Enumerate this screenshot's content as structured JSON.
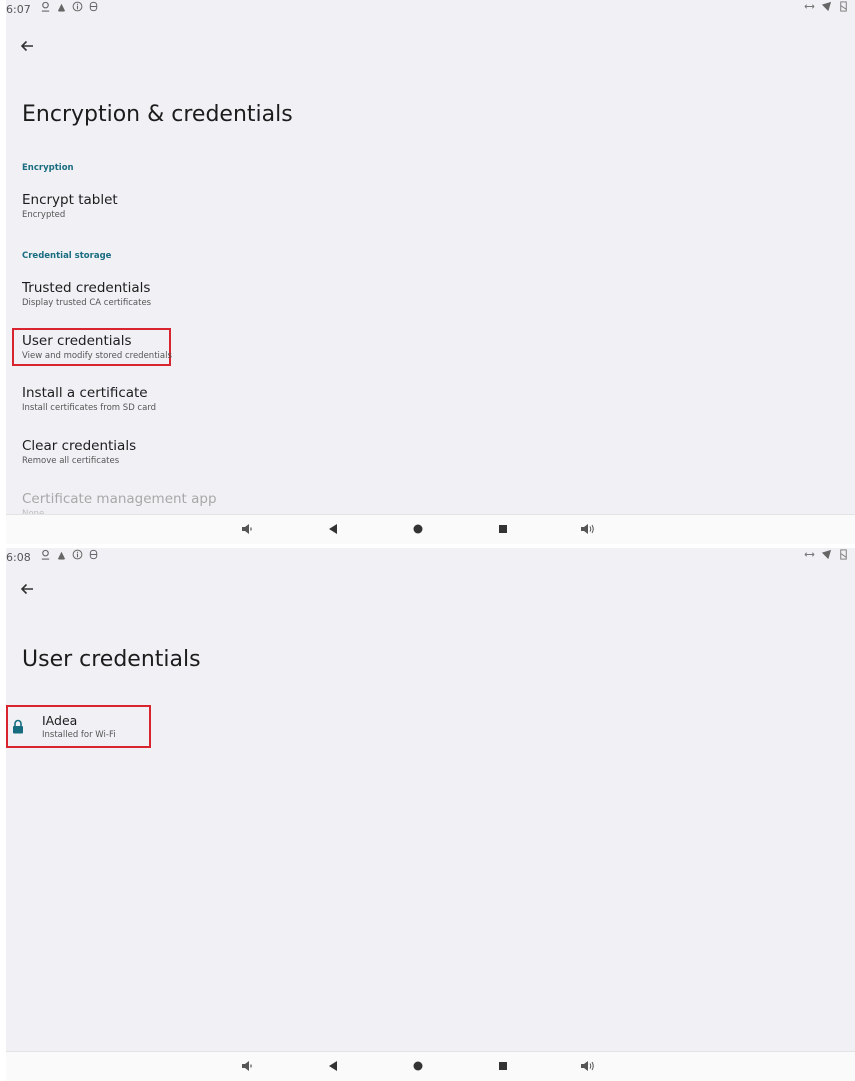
{
  "screen1": {
    "status_time": "6:07",
    "title": "Encryption & credentials",
    "sections": {
      "encryption": "Encryption",
      "credential_storage": "Credential storage"
    },
    "items": [
      {
        "title": "Encrypt tablet",
        "subtitle": "Encrypted"
      },
      {
        "title": "Trusted credentials",
        "subtitle": "Display trusted CA certificates"
      },
      {
        "title": "User credentials",
        "subtitle": "View and modify stored credentials"
      },
      {
        "title": "Install a certificate",
        "subtitle": "Install certificates from SD card"
      },
      {
        "title": "Clear credentials",
        "subtitle": "Remove all certificates"
      },
      {
        "title": "Certificate management app",
        "subtitle": "None"
      }
    ]
  },
  "screen2": {
    "status_time": "6:08",
    "title": "User credentials",
    "credentials": [
      {
        "name": "IAdea",
        "subtitle": "Installed for Wi-Fi"
      }
    ]
  },
  "icons": {
    "status_left": [
      "location-icon",
      "notification-icon",
      "info-icon",
      "storage-icon"
    ],
    "status_right": [
      "data-arrows-icon",
      "wifi-icon",
      "battery-icon"
    ],
    "back": "back-arrow-icon",
    "lock": "lock-icon",
    "nav": [
      "volume-down-icon",
      "back-triangle-icon",
      "home-circle-icon",
      "recents-square-icon",
      "volume-up-icon"
    ]
  },
  "colors": {
    "background": "#f1f1f5",
    "section_header": "#1a6d80",
    "highlight": "#d8242f",
    "lock": "#176c80"
  }
}
